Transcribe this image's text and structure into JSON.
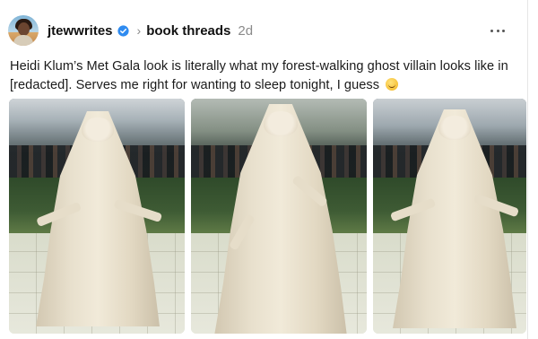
{
  "post": {
    "username": "jtewwrites",
    "verified": true,
    "thread_name": "book threads",
    "time": "2d",
    "more_icon": "more-horizontal-icon",
    "text": "Heidi Klum’s Met Gala look is literally what my forest-walking ghost villain looks like in [redacted]. Serves me right for wanting to sleep tonight, I guess",
    "emoji": "grinning-sweat-emoji"
  },
  "colors": {
    "verified_blue": "#2f8bf0",
    "meta_gray": "#8a8a8a",
    "text": "#1a1a1a"
  },
  "photos": [
    {
      "name": "photo-1"
    },
    {
      "name": "photo-2"
    },
    {
      "name": "photo-3"
    }
  ]
}
